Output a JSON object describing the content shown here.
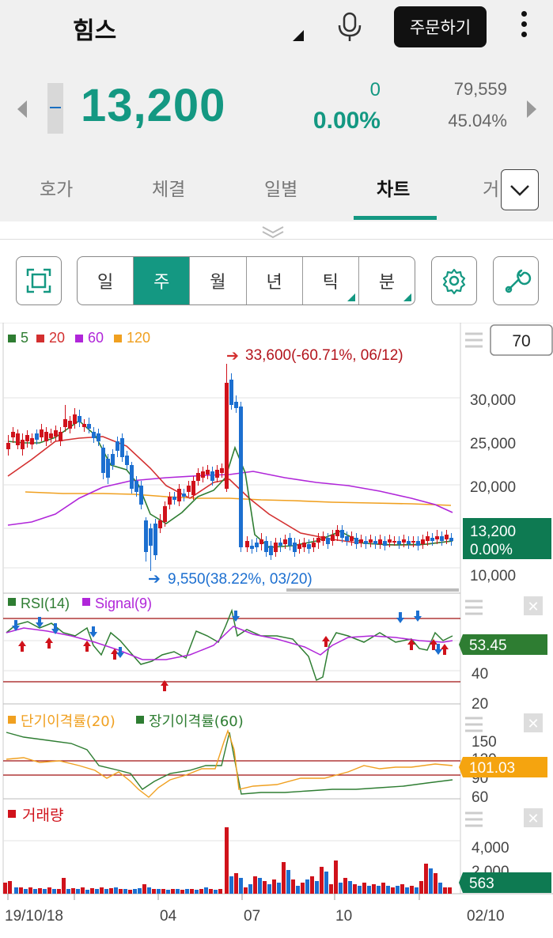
{
  "header": {
    "stock_name": "힘스",
    "order_button": "주문하기"
  },
  "quote": {
    "price": "13,200",
    "change": "0",
    "change_pct": "0.00%",
    "volume": "79,559",
    "volume_pct": "45.04%"
  },
  "tabs": [
    {
      "label": "호가",
      "active": false
    },
    {
      "label": "체결",
      "active": false
    },
    {
      "label": "일별",
      "active": false
    },
    {
      "label": "차트",
      "active": true
    },
    {
      "label": "거",
      "active": false
    }
  ],
  "periods": [
    {
      "label": "일",
      "active": false,
      "submenu": false
    },
    {
      "label": "주",
      "active": true,
      "submenu": false
    },
    {
      "label": "월",
      "active": false,
      "submenu": false
    },
    {
      "label": "년",
      "active": false,
      "submenu": false
    },
    {
      "label": "틱",
      "active": false,
      "submenu": true
    },
    {
      "label": "분",
      "active": false,
      "submenu": true
    }
  ],
  "toolbar_icons": [
    "fullscreen-icon",
    "settings-gear-icon",
    "wrench-icon"
  ],
  "chart": {
    "count_box": "70",
    "ma_legend": [
      {
        "label": "5",
        "color": "#2e7d32"
      },
      {
        "label": "20",
        "color": "#d32f2f"
      },
      {
        "label": "60",
        "color": "#b026d9"
      },
      {
        "label": "120",
        "color": "#f0a020"
      }
    ],
    "high_annotation": "33,600(-60.71%, 06/12)",
    "low_annotation": "9,550(38.22%, 03/20)",
    "price_ticks": [
      "30,000",
      "25,000",
      "20,000",
      "15,000",
      "10,000"
    ],
    "current_price_label": "13,200",
    "current_pct_label": "0.00%",
    "rsi_legend": "RSI(14)",
    "signal_legend": "Signal(9)",
    "rsi_ticks": [
      "40",
      "20"
    ],
    "rsi_value": "53.45",
    "disparity_legend_short": "단기이격률(20)",
    "disparity_legend_long": "장기이격률(60)",
    "disparity_ticks": [
      "150",
      "120",
      "90",
      "60"
    ],
    "disparity_value": "101.03",
    "volume_legend": "거래량",
    "volume_ticks": [
      "4,000",
      "2,000"
    ],
    "volume_value": "563",
    "x_labels": [
      "19/10/18",
      "04",
      "07",
      "10",
      "02/10"
    ],
    "colors": {
      "up": "#d0121b",
      "down": "#1c6fd0",
      "accent": "#149882"
    }
  },
  "chart_data": {
    "type": "line",
    "title": "",
    "x": [
      "19/10/18",
      "04",
      "07",
      "10",
      "02/10"
    ],
    "series": [
      {
        "name": "5",
        "values": [
          23800,
          23500,
          24500,
          16500,
          11800,
          19800,
          13200,
          12600,
          13300,
          13200
        ]
      },
      {
        "name": "20",
        "values": [
          22500,
          24000,
          24400,
          20500,
          15800,
          17800,
          15000,
          13200,
          12900,
          13200
        ]
      },
      {
        "name": "60",
        "values": [
          15600,
          17600,
          19200,
          20200,
          20400,
          19600,
          19000,
          18200,
          17000,
          15100
        ]
      },
      {
        "name": "120",
        "values": [
          17500,
          17400,
          17200,
          16900,
          16900,
          17100,
          17000,
          16800,
          16700,
          16400
        ]
      }
    ],
    "annotations": [
      {
        "label": "33,600(-60.71%, 06/12)",
        "value": 33600
      },
      {
        "label": "9,550(38.22%, 03/20)",
        "value": 9550
      }
    ],
    "ylim": [
      9000,
      34500
    ],
    "y_ticks": [
      30000,
      25000,
      20000,
      15000,
      10000
    ],
    "current": 13200,
    "rsi": {
      "value": 53.45,
      "ticks": [
        40,
        20
      ]
    },
    "disparity": {
      "value": 101.03,
      "ticks": [
        150,
        120,
        90,
        60
      ]
    },
    "volume": {
      "value": 563,
      "ticks": [
        4000,
        2000
      ]
    }
  }
}
